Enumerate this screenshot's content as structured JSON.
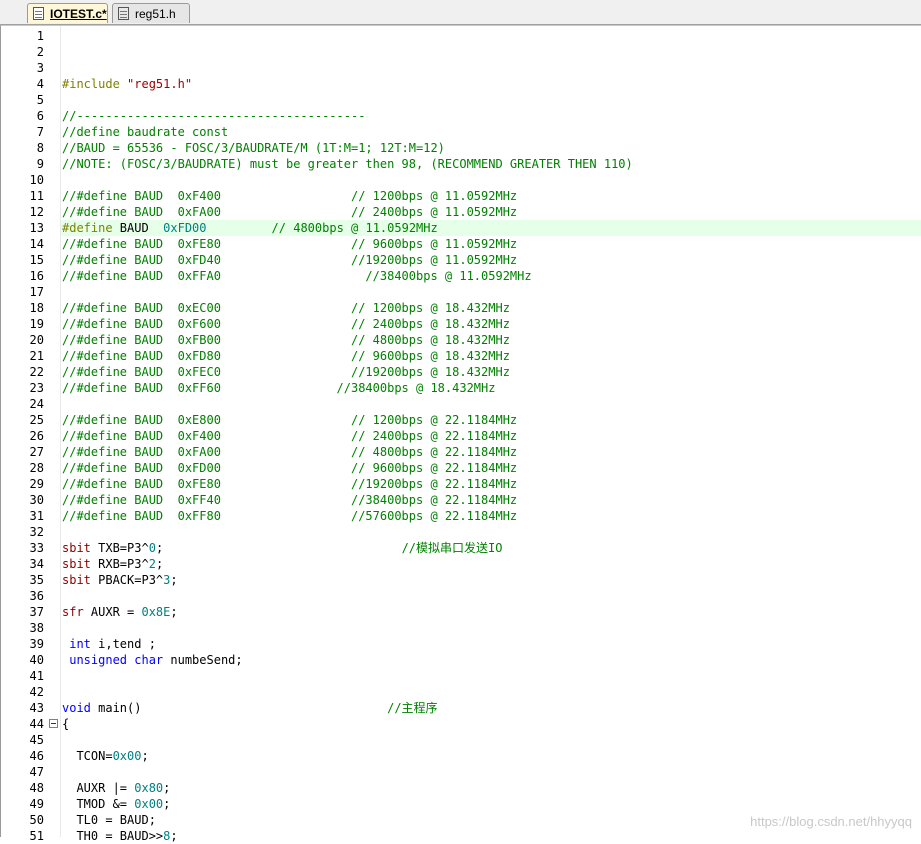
{
  "tabs": [
    {
      "label": "IOTEST.c*",
      "active": true,
      "icon": "c-file-icon"
    },
    {
      "label": "reg51.h",
      "active": false,
      "icon": "h-file-icon"
    }
  ],
  "colors": {
    "comment": "#008000",
    "keyword": "#0000ff",
    "type_keyword": "#8b0000",
    "preprocessor": "#808000",
    "string": "#a00000",
    "number": "#008080",
    "current_line_highlight": "#e6ffe9",
    "active_tab": "#fff8d8"
  },
  "editor": {
    "highlighted_line": 13,
    "fold_marker_line": 44,
    "lines": [
      {
        "n": "1",
        "tokens": []
      },
      {
        "n": "2",
        "tokens": []
      },
      {
        "n": "3",
        "tokens": []
      },
      {
        "n": "4",
        "tokens": [
          {
            "t": "#include ",
            "c": "pp"
          },
          {
            "t": "\"reg51.h\"",
            "c": "str"
          }
        ]
      },
      {
        "n": "5",
        "tokens": []
      },
      {
        "n": "6",
        "tokens": [
          {
            "t": "//----------------------------------------",
            "c": "cm"
          }
        ]
      },
      {
        "n": "7",
        "tokens": [
          {
            "t": "//define baudrate const",
            "c": "cm"
          }
        ]
      },
      {
        "n": "8",
        "tokens": [
          {
            "t": "//BAUD = 65536 - FOSC/3/BAUDRATE/M (1T:M=1; 12T:M=12)",
            "c": "cm"
          }
        ]
      },
      {
        "n": "9",
        "tokens": [
          {
            "t": "//NOTE: (FOSC/3/BAUDRATE) must be greater then 98, (RECOMMEND GREATER THEN 110)",
            "c": "cm"
          }
        ]
      },
      {
        "n": "10",
        "tokens": []
      },
      {
        "n": "11",
        "tokens": [
          {
            "t": "//#define BAUD  0xF400                  // 1200bps @ 11.0592MHz",
            "c": "cm"
          }
        ]
      },
      {
        "n": "12",
        "tokens": [
          {
            "t": "//#define BAUD  0xFA00                  // 2400bps @ 11.0592MHz",
            "c": "cm"
          }
        ]
      },
      {
        "n": "13",
        "tokens": [
          {
            "t": "#define ",
            "c": "pp"
          },
          {
            "t": "BAUD  ",
            "c": "id"
          },
          {
            "t": "0xFD00",
            "c": "num"
          },
          {
            "t": "         ",
            "c": "id"
          },
          {
            "t": "// 4800bps @ 11.0592MHz",
            "c": "cm"
          }
        ]
      },
      {
        "n": "14",
        "tokens": [
          {
            "t": "//#define BAUD  0xFE80                  // 9600bps @ 11.0592MHz",
            "c": "cm"
          }
        ]
      },
      {
        "n": "15",
        "tokens": [
          {
            "t": "//#define BAUD  0xFD40                  //19200bps @ 11.0592MHz",
            "c": "cm"
          }
        ]
      },
      {
        "n": "16",
        "tokens": [
          {
            "t": "//#define BAUD  0xFFA0                    //38400bps @ 11.0592MHz",
            "c": "cm"
          }
        ]
      },
      {
        "n": "17",
        "tokens": []
      },
      {
        "n": "18",
        "tokens": [
          {
            "t": "//#define BAUD  0xEC00                  // 1200bps @ 18.432MHz",
            "c": "cm"
          }
        ]
      },
      {
        "n": "19",
        "tokens": [
          {
            "t": "//#define BAUD  0xF600                  // 2400bps @ 18.432MHz",
            "c": "cm"
          }
        ]
      },
      {
        "n": "20",
        "tokens": [
          {
            "t": "//#define BAUD  0xFB00                  // 4800bps @ 18.432MHz",
            "c": "cm"
          }
        ]
      },
      {
        "n": "21",
        "tokens": [
          {
            "t": "//#define BAUD  0xFD80                  // 9600bps @ 18.432MHz",
            "c": "cm"
          }
        ]
      },
      {
        "n": "22",
        "tokens": [
          {
            "t": "//#define BAUD  0xFEC0                  //19200bps @ 18.432MHz",
            "c": "cm"
          }
        ]
      },
      {
        "n": "23",
        "tokens": [
          {
            "t": "//#define BAUD  0xFF60                //38400bps @ 18.432MHz",
            "c": "cm"
          }
        ]
      },
      {
        "n": "24",
        "tokens": []
      },
      {
        "n": "25",
        "tokens": [
          {
            "t": "//#define BAUD  0xE800                  // 1200bps @ 22.1184MHz",
            "c": "cm"
          }
        ]
      },
      {
        "n": "26",
        "tokens": [
          {
            "t": "//#define BAUD  0xF400                  // 2400bps @ 22.1184MHz",
            "c": "cm"
          }
        ]
      },
      {
        "n": "27",
        "tokens": [
          {
            "t": "//#define BAUD  0xFA00                  // 4800bps @ 22.1184MHz",
            "c": "cm"
          }
        ]
      },
      {
        "n": "28",
        "tokens": [
          {
            "t": "//#define BAUD  0xFD00                  // 9600bps @ 22.1184MHz",
            "c": "cm"
          }
        ]
      },
      {
        "n": "29",
        "tokens": [
          {
            "t": "//#define BAUD  0xFE80                  //19200bps @ 22.1184MHz",
            "c": "cm"
          }
        ]
      },
      {
        "n": "30",
        "tokens": [
          {
            "t": "//#define BAUD  0xFF40                  //38400bps @ 22.1184MHz",
            "c": "cm"
          }
        ]
      },
      {
        "n": "31",
        "tokens": [
          {
            "t": "//#define BAUD  0xFF80                  //57600bps @ 22.1184MHz",
            "c": "cm"
          }
        ]
      },
      {
        "n": "32",
        "tokens": []
      },
      {
        "n": "33",
        "tokens": [
          {
            "t": "sbit ",
            "c": "kw2"
          },
          {
            "t": "TXB=P3^",
            "c": "id"
          },
          {
            "t": "0",
            "c": "num"
          },
          {
            "t": ";                                 ",
            "c": "id"
          },
          {
            "t": "//模拟串口发送IO",
            "c": "cm"
          }
        ]
      },
      {
        "n": "34",
        "tokens": [
          {
            "t": "sbit ",
            "c": "kw2"
          },
          {
            "t": "RXB=P3^",
            "c": "id"
          },
          {
            "t": "2",
            "c": "num"
          },
          {
            "t": ";",
            "c": "id"
          }
        ]
      },
      {
        "n": "35",
        "tokens": [
          {
            "t": "sbit ",
            "c": "kw2"
          },
          {
            "t": "PBACK=P3^",
            "c": "id"
          },
          {
            "t": "3",
            "c": "num"
          },
          {
            "t": ";",
            "c": "id"
          }
        ]
      },
      {
        "n": "36",
        "tokens": []
      },
      {
        "n": "37",
        "tokens": [
          {
            "t": "sfr ",
            "c": "kw2"
          },
          {
            "t": "AUXR = ",
            "c": "id"
          },
          {
            "t": "0x8E",
            "c": "num"
          },
          {
            "t": ";",
            "c": "id"
          }
        ]
      },
      {
        "n": "38",
        "tokens": []
      },
      {
        "n": "39",
        "tokens": [
          {
            "t": " int ",
            "c": "kw"
          },
          {
            "t": "i,tend ;",
            "c": "id"
          }
        ]
      },
      {
        "n": "40",
        "tokens": [
          {
            "t": " unsigned char ",
            "c": "kw"
          },
          {
            "t": "numbeSend;",
            "c": "id"
          }
        ]
      },
      {
        "n": "41",
        "tokens": []
      },
      {
        "n": "42",
        "tokens": []
      },
      {
        "n": "43",
        "tokens": [
          {
            "t": "void ",
            "c": "kw"
          },
          {
            "t": "main()                                  ",
            "c": "id"
          },
          {
            "t": "//主程序",
            "c": "cm"
          }
        ]
      },
      {
        "n": "44",
        "tokens": [
          {
            "t": "{",
            "c": "id"
          }
        ]
      },
      {
        "n": "45",
        "tokens": []
      },
      {
        "n": "46",
        "tokens": [
          {
            "t": "  TCON=",
            "c": "id"
          },
          {
            "t": "0x00",
            "c": "num"
          },
          {
            "t": ";",
            "c": "id"
          }
        ]
      },
      {
        "n": "47",
        "tokens": []
      },
      {
        "n": "48",
        "tokens": [
          {
            "t": "  AUXR |= ",
            "c": "id"
          },
          {
            "t": "0x80",
            "c": "num"
          },
          {
            "t": ";",
            "c": "id"
          }
        ]
      },
      {
        "n": "49",
        "tokens": [
          {
            "t": "  TMOD &= ",
            "c": "id"
          },
          {
            "t": "0x00",
            "c": "num"
          },
          {
            "t": ";",
            "c": "id"
          }
        ]
      },
      {
        "n": "50",
        "tokens": [
          {
            "t": "  TL0 = BAUD;",
            "c": "id"
          }
        ]
      },
      {
        "n": "51",
        "tokens": [
          {
            "t": "  TH0 = BAUD>>",
            "c": "id"
          },
          {
            "t": "8",
            "c": "num"
          },
          {
            "t": ";",
            "c": "id"
          }
        ]
      }
    ]
  },
  "watermark": "https://blog.csdn.net/hhyyqq"
}
